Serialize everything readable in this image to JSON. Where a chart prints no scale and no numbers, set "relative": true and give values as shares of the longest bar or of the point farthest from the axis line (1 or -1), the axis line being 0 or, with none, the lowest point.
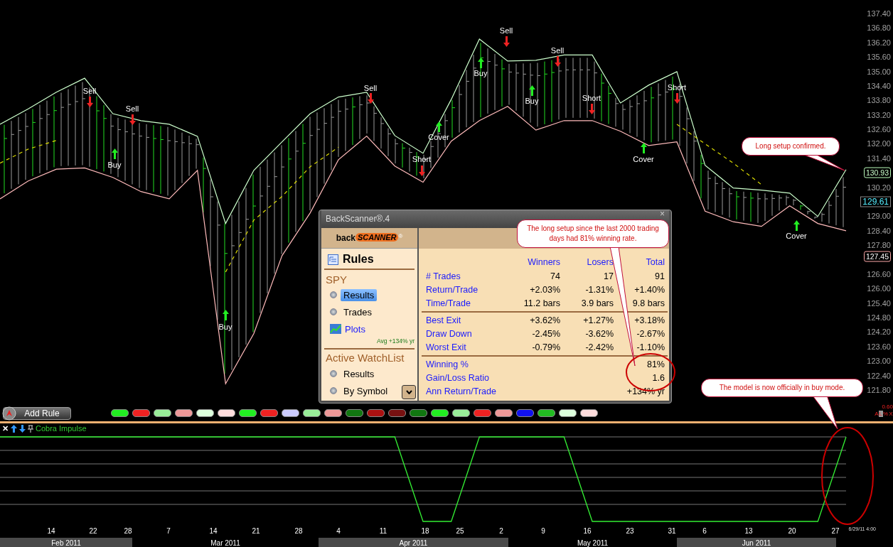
{
  "chart": {
    "chart_data": {
      "type": "line",
      "ylim": [
        121.8,
        137.4
      ],
      "categories": [
        null,
        null,
        null,
        null,
        null,
        null,
        null,
        null,
        null,
        null,
        null,
        null,
        null,
        null,
        null,
        null,
        null,
        null,
        null,
        null,
        null,
        null,
        null,
        null,
        null,
        null,
        null,
        null,
        null,
        null,
        null
      ],
      "yticks": [
        {
          "value": 137.4,
          "label": "137.40"
        },
        {
          "value": 136.8,
          "label": "136.80"
        },
        {
          "value": 136.2,
          "label": "136.20"
        },
        {
          "value": 135.6,
          "label": "135.60"
        },
        {
          "value": 135,
          "label": "135.00"
        },
        {
          "value": 134.4,
          "label": "134.40"
        },
        {
          "value": 133.8,
          "label": "133.80"
        },
        {
          "value": 133.2,
          "label": "133.20"
        },
        {
          "value": 132.6,
          "label": "132.60"
        },
        {
          "value": 132,
          "label": "132.00"
        },
        {
          "value": 131.4,
          "label": "131.40"
        },
        {
          "value": 130.2,
          "label": "130.20"
        },
        {
          "value": 129,
          "label": "129.00"
        },
        {
          "value": 128.4,
          "label": "128.40"
        },
        {
          "value": 127.8,
          "label": "127.80"
        },
        {
          "value": 126.6,
          "label": "126.60"
        },
        {
          "value": 126,
          "label": "126.00"
        },
        {
          "value": 125.4,
          "label": "125.40"
        },
        {
          "value": 124.8,
          "label": "124.80"
        },
        {
          "value": 124.2,
          "label": "124.20"
        },
        {
          "value": 123.6,
          "label": "123.60"
        },
        {
          "value": 123,
          "label": "123.00"
        },
        {
          "value": 122.4,
          "label": "122.40"
        },
        {
          "value": 121.8,
          "label": "121.80"
        }
      ],
      "series": [
        {
          "color": "#ccffcc",
          "values": [
            132.81,
            133.45,
            134.14,
            134.72,
            133.25,
            132.96,
            132.81,
            132.31,
            128.7,
            130.9,
            132.08,
            133.25,
            133.94,
            134.14,
            132.34,
            131.61,
            133.84,
            136.34,
            135.43,
            135.46,
            135.68,
            135.68,
            133.69,
            134.43,
            134.99,
            131.11,
            130.17,
            130.08,
            129.96,
            128.99,
            130.93
          ]
        },
        {
          "color": "#ffbbbb",
          "values": [
            129.72,
            130.46,
            130.95,
            131.0,
            130.61,
            130.02,
            129.72,
            130.9,
            122.06,
            124.14,
            127.37,
            129.14,
            131.34,
            132.32,
            131.08,
            130.41,
            132.11,
            132.96,
            133.55,
            132.57,
            132.96,
            132.96,
            132.52,
            131.93,
            132.08,
            129.21,
            128.77,
            128.58,
            129.43,
            128.7,
            128.4
          ]
        },
        {
          "color": "#dddd00",
          "line_style": "dashed",
          "values": [
            131.2,
            131.78,
            132.14,
            null,
            null,
            null,
            null,
            null,
            126.69,
            128.84,
            129.82,
            131.05,
            131.86,
            null,
            null,
            null,
            null,
            null,
            null,
            null,
            null,
            null,
            null,
            null,
            132.81,
            132.0,
            131.2,
            130.31,
            null,
            null,
            null
          ]
        }
      ]
    },
    "price_tags": [
      {
        "kind": "high",
        "text": "130.93"
      },
      {
        "kind": "last",
        "text": "129.61"
      },
      {
        "kind": "low",
        "text": "127.45"
      }
    ],
    "signals": [
      {
        "kind": "sell",
        "label": "Sell"
      },
      {
        "kind": "buy",
        "label": "Buy"
      },
      {
        "kind": "sell",
        "label": "Sell"
      },
      {
        "kind": "buy",
        "label": "Buy"
      },
      {
        "kind": "sell",
        "label": "Sell"
      },
      {
        "kind": "short",
        "label": "Short"
      },
      {
        "kind": "cover",
        "label": "Cover"
      },
      {
        "kind": "buy",
        "label": "Buy"
      },
      {
        "kind": "sell",
        "label": "Sell"
      },
      {
        "kind": "buy",
        "label": "Buy"
      },
      {
        "kind": "sell",
        "label": "Sell"
      },
      {
        "kind": "short",
        "label": "Short"
      },
      {
        "kind": "cover",
        "label": "Cover"
      },
      {
        "kind": "short",
        "label": "Short"
      },
      {
        "kind": "cover",
        "label": "Cover"
      }
    ],
    "callouts": [
      "Long setup confirmed.",
      "The model is now officially in buy mode."
    ],
    "scale_step": "0.60",
    "axis_modes": [
      {
        "label": "A",
        "selected": false
      },
      {
        "label": "L",
        "selected": true
      },
      {
        "label": "%",
        "selected": false
      },
      {
        "label": "X",
        "selected": false
      }
    ]
  },
  "toolbar": {
    "add_rule": "Add Rule",
    "swatches": [
      {
        "color": "#22ee22"
      },
      {
        "color": "#ee2222"
      },
      {
        "color": "#99ee99"
      },
      {
        "color": "#ee9999"
      },
      {
        "color": "#ddffdd"
      },
      {
        "color": "#ffdddd"
      },
      {
        "color": "#22ee22"
      },
      {
        "color": "#ee2222"
      },
      {
        "color": "#ccccff"
      },
      {
        "color": "#99ee99"
      },
      {
        "color": "#ee9999"
      },
      {
        "color": "#117711"
      },
      {
        "color": "#aa1111"
      },
      {
        "color": "#771111"
      },
      {
        "color": "#117711"
      },
      {
        "color": "#22ee22"
      },
      {
        "color": "#99ee99"
      },
      {
        "color": "#ee2222"
      },
      {
        "color": "#ee9999"
      },
      {
        "color": "#1111ee"
      },
      {
        "color": "#22bb22"
      },
      {
        "color": "#ddffdd"
      },
      {
        "color": "#ffdddd"
      }
    ]
  },
  "indicator_panel": {
    "close": "✕",
    "title": "Cobra Impulse",
    "chart_data": {
      "type": "line",
      "relative": true,
      "categories": [
        null,
        null,
        null,
        null,
        null,
        null,
        null,
        null,
        null,
        null,
        null,
        null,
        null,
        null,
        null,
        null,
        null,
        null,
        null,
        null,
        null,
        null,
        null,
        null,
        null,
        null,
        null,
        null,
        null,
        null,
        null
      ],
      "series": [
        {
          "color": "#33ee33",
          "values": [
            1,
            1,
            1,
            1,
            1,
            1,
            1,
            1,
            1,
            1,
            1,
            1,
            1,
            1,
            1,
            0,
            0,
            1,
            1,
            1,
            1,
            0,
            0,
            0,
            0,
            0,
            0,
            0,
            0,
            0,
            1
          ]
        }
      ]
    }
  },
  "x_axis": {
    "days": [
      "14",
      "22",
      "28",
      "7",
      "14",
      "21",
      "28",
      "4",
      "11",
      "18",
      "25",
      "2",
      "9",
      "16",
      "23",
      "31",
      "6",
      "13",
      "20",
      "27"
    ],
    "months": [
      {
        "label": "Feb 2011",
        "shaded": true
      },
      {
        "label": "Mar 2011",
        "shaded": false
      },
      {
        "label": "Apr 2011",
        "shaded": true
      },
      {
        "label": "May 2011",
        "shaded": false
      },
      {
        "label": "Jun 2011",
        "shaded": true
      }
    ],
    "timestamp": "6/29/11 4:00"
  },
  "dialog": {
    "title": "BackScanner®.4",
    "close": "×",
    "logo": {
      "left": "back",
      "right": "SCANNER",
      "mark": "®"
    },
    "heading": "Rules",
    "symbol": "SPY",
    "symbol_items": [
      {
        "kind": "radio",
        "label": "Results",
        "selected": true
      },
      {
        "kind": "radio",
        "label": "Trades",
        "selected": false
      },
      {
        "kind": "plot",
        "label": "Plots",
        "selected": false
      }
    ],
    "average": "Avg +134% yr",
    "watchlist": "Active WatchList",
    "watchlist_items": [
      {
        "kind": "radio",
        "label": "Results",
        "selected": false
      },
      {
        "kind": "radio",
        "label": "By Symbol",
        "selected": false
      }
    ],
    "callout": "The long setup since the last 2000 trading days had 81% winning rate.",
    "columns": [
      "Winners",
      "Losers",
      "Total"
    ],
    "groups": [
      [
        {
          "label": "# Trades",
          "values": [
            "74",
            "17",
            "91"
          ]
        },
        {
          "label": "Return/Trade",
          "values": [
            "+2.03%",
            "-1.31%",
            "+1.40%"
          ]
        },
        {
          "label": "Time/Trade",
          "values": [
            "11.2 bars",
            "3.9 bars",
            "9.8 bars"
          ]
        }
      ],
      [
        {
          "label": "Best Exit",
          "values": [
            "+3.62%",
            "+1.27%",
            "+3.18%"
          ]
        },
        {
          "label": "Draw Down",
          "values": [
            "-2.45%",
            "-3.62%",
            "-2.67%"
          ]
        },
        {
          "label": "Worst Exit",
          "values": [
            "-0.79%",
            "-2.42%",
            "-1.10%"
          ]
        }
      ],
      [
        {
          "label": "Winning %",
          "total": "81%"
        },
        {
          "label": "Gain/Loss Ratio",
          "total": "1.6"
        },
        {
          "label": "Ann Return/Trade",
          "total": "+134% yr"
        }
      ]
    ]
  }
}
